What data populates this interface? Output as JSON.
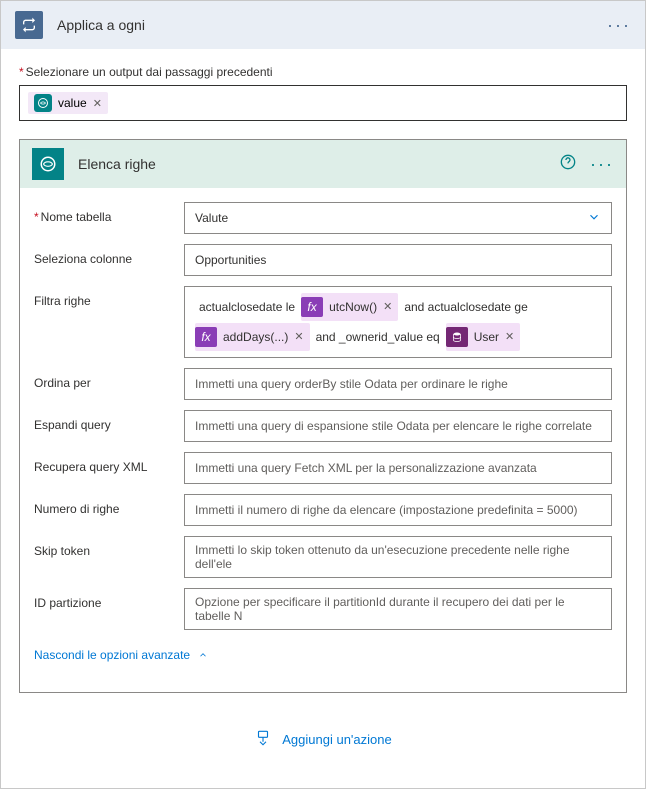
{
  "header": {
    "title": "Applica a ogni"
  },
  "selectOutput": {
    "label": "Selezionare un output dai passaggi precedenti",
    "token": "value"
  },
  "innerCard": {
    "title": "Elenca righe",
    "rows": {
      "tableName": {
        "label": "Nome tabella",
        "value": "Valute"
      },
      "selectColumns": {
        "label": "Seleziona colonne",
        "value": "Opportunities"
      },
      "filterRows": {
        "label": "Filtra righe",
        "parts": {
          "t1": "actualclosedate le",
          "fx1": "utcNow()",
          "t2": "and actualclosedate ge",
          "fx2": "addDays(...)",
          "t3": "and _ownerid_value eq",
          "user": "User"
        }
      },
      "orderBy": {
        "label": "Ordina per",
        "placeholder": "Immetti una query orderBy stile Odata per ordinare le righe"
      },
      "expandQuery": {
        "label": "Espandi query",
        "placeholder": "Immetti una query di espansione stile Odata per elencare le righe correlate"
      },
      "fetchXml": {
        "label": "Recupera query XML",
        "placeholder": "Immetti una query Fetch XML per la personalizzazione avanzata"
      },
      "rowCount": {
        "label": "Numero di righe",
        "placeholder": "Immetti il numero di righe da elencare (impostazione predefinita = 5000)"
      },
      "skipToken": {
        "label": "Skip token",
        "placeholder": "Immetti lo skip token ottenuto da un'esecuzione precedente nelle righe dell'ele"
      },
      "partitionId": {
        "label": "ID partizione",
        "placeholder": "Opzione per specificare il partitionId durante il recupero dei dati per le tabelle N"
      }
    },
    "advancedLink": "Nascondi le opzioni avanzate"
  },
  "addAction": "Aggiungi un'azione"
}
